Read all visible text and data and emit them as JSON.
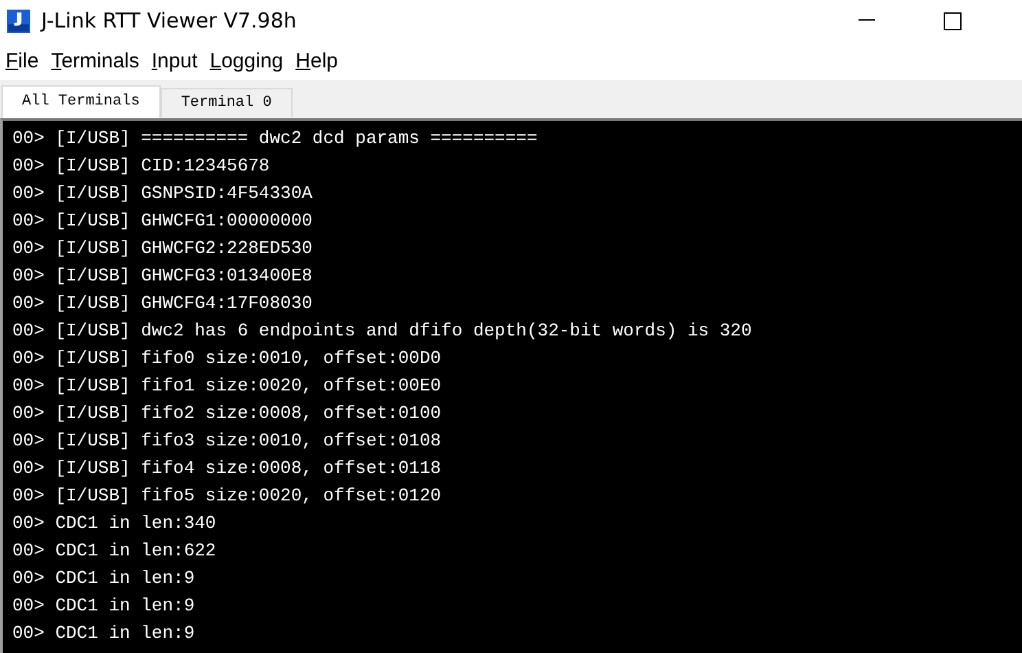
{
  "window": {
    "title": "J-Link RTT Viewer V7.98h"
  },
  "menu": [
    "File",
    "Terminals",
    "Input",
    "Logging",
    "Help"
  ],
  "tabs": [
    {
      "label": "All Terminals",
      "selected": true
    },
    {
      "label": "Terminal 0",
      "selected": false
    }
  ],
  "terminal": {
    "lines": [
      "00> [I/USB] ========== dwc2 dcd params ==========",
      "00> [I/USB] CID:12345678",
      "00> [I/USB] GSNPSID:4F54330A",
      "00> [I/USB] GHWCFG1:00000000",
      "00> [I/USB] GHWCFG2:228ED530",
      "00> [I/USB] GHWCFG3:013400E8",
      "00> [I/USB] GHWCFG4:17F08030",
      "00> [I/USB] dwc2 has 6 endpoints and dfifo depth(32-bit words) is 320",
      "00> [I/USB] fifo0 size:0010, offset:00D0",
      "00> [I/USB] fifo1 size:0020, offset:00E0",
      "00> [I/USB] fifo2 size:0008, offset:0100",
      "00> [I/USB] fifo3 size:0010, offset:0108",
      "00> [I/USB] fifo4 size:0008, offset:0118",
      "00> [I/USB] fifo5 size:0020, offset:0120",
      "00> CDC1 in len:340",
      "00> CDC1 in len:622",
      "00> CDC1 in len:9",
      "00> CDC1 in len:9",
      "00> CDC1 in len:9"
    ]
  }
}
